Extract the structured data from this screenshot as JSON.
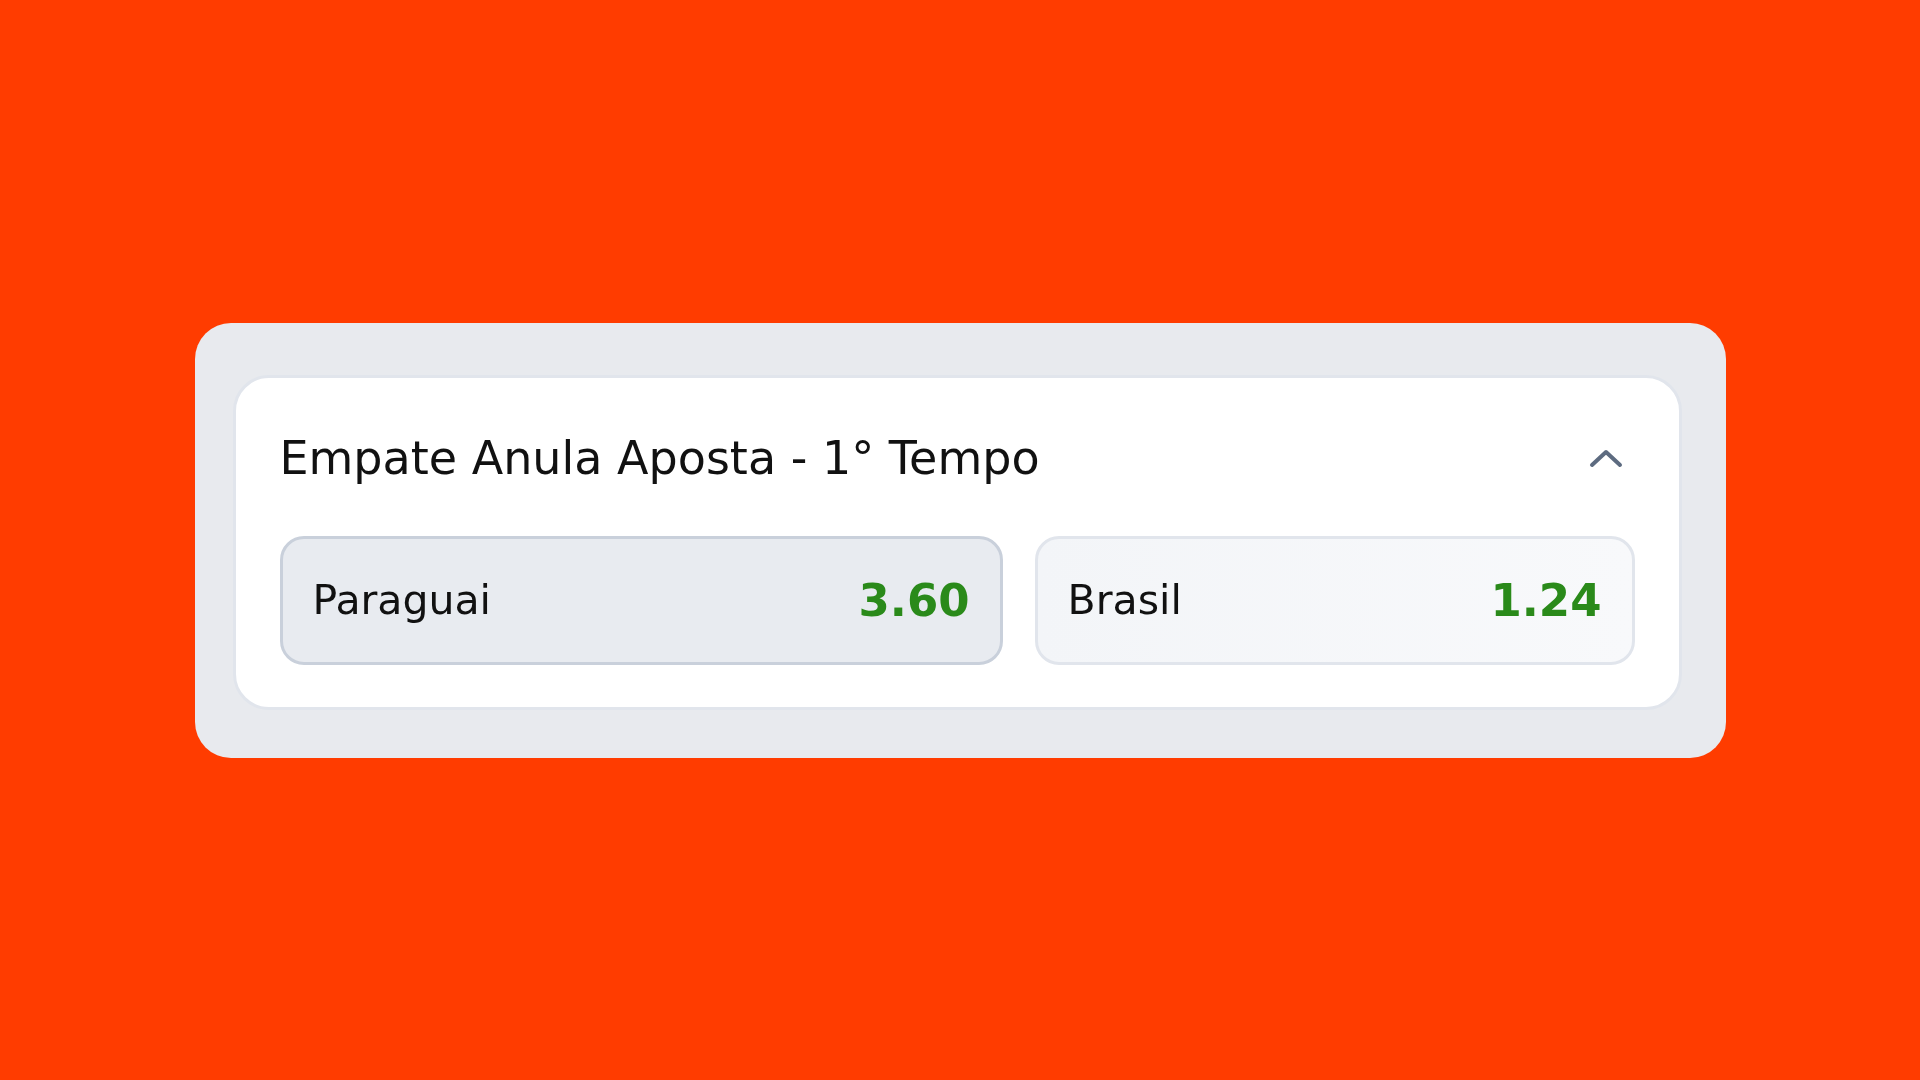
{
  "market": {
    "title": "Empate Anula Aposta - 1° Tempo",
    "expanded": true,
    "options": [
      {
        "label": "Paraguai",
        "odds": "3.60",
        "selected": true
      },
      {
        "label": "Brasil",
        "odds": "1.24",
        "selected": false
      }
    ]
  }
}
